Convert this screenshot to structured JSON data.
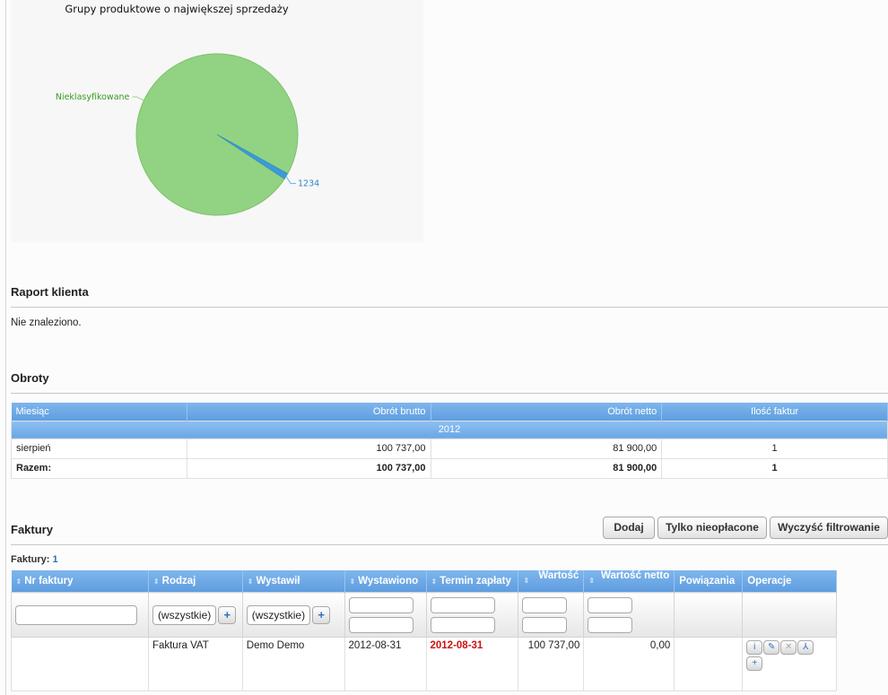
{
  "pie_chart": {
    "title": "Grupy produktowe o największej sprzedaży",
    "slices": [
      {
        "label": "Nieklasyfikowane",
        "share": 0.988,
        "color": "#92d283"
      },
      {
        "label": "1234",
        "share": 0.012,
        "color": "#3b9bd9"
      }
    ],
    "label_colors": {
      "Nieklasyfikowane": "#3a9a20",
      "1234": "#2f86c9"
    }
  },
  "client_report": {
    "title": "Raport klienta",
    "message": "Nie znaleziono."
  },
  "turnover": {
    "title": "Obroty",
    "columns": [
      "Miesiąc",
      "Obrót brutto",
      "Obrót netto",
      "Ilość faktur"
    ],
    "year": "2012",
    "rows": [
      {
        "month": "sierpień",
        "gross": "100 737,00",
        "net": "81 900,00",
        "count": "1"
      }
    ],
    "total": {
      "label": "Razem:",
      "gross": "100 737,00",
      "net": "81 900,00",
      "count": "1"
    }
  },
  "invoices": {
    "title": "Faktury",
    "buttons": {
      "add": "Dodaj",
      "unpaid_only": "Tylko nieopłacone",
      "clear_filter": "Wyczyść filtrowanie"
    },
    "count_label": "Faktury:",
    "count_value": "1",
    "columns": [
      "Nr faktury",
      "Rodzaj",
      "Wystawił",
      "Wystawiono",
      "Termin zapłaty",
      "Wartość",
      "Wartość netto",
      "Powiązania",
      "Operacje"
    ],
    "filters": {
      "type_select": "(wszystkie)",
      "issuer_select": "(wszystkie)",
      "add_symbol": "+"
    },
    "rows": [
      {
        "number": "",
        "type": "Faktura VAT",
        "issuer": "Demo Demo",
        "issued": "2012-08-31",
        "due": "2012-08-31",
        "value": "100 737,00",
        "net_value": "0,00",
        "links": ""
      }
    ],
    "operation_icons": [
      "info-icon",
      "edit-icon",
      "delete-icon",
      "pdf-icon",
      "add-icon"
    ],
    "accent_header_color": "#6aa7e6",
    "due_color": "#cc1111"
  }
}
